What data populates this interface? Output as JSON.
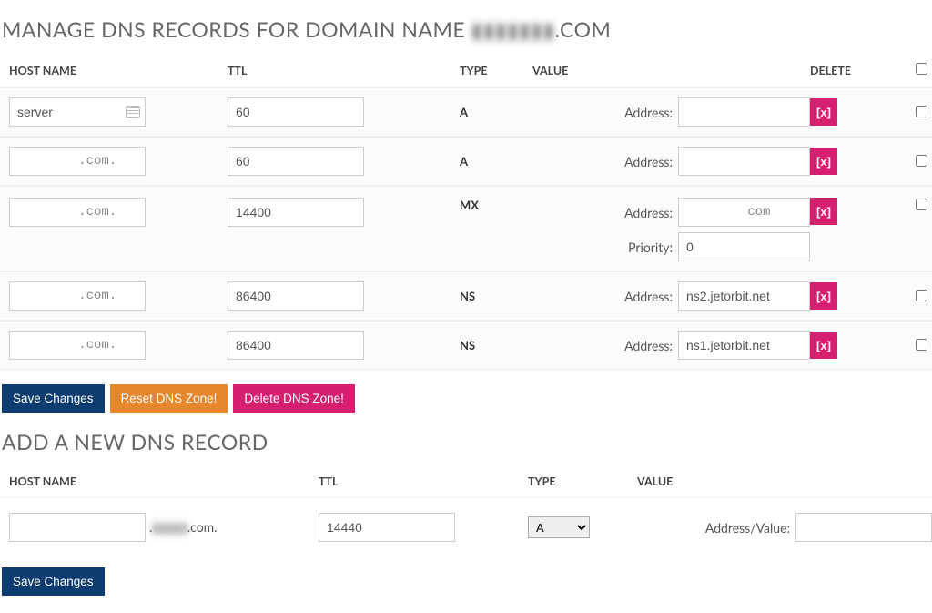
{
  "heading_prefix": "MANAGE DNS RECORDS FOR DOMAIN NAME ",
  "heading_domain_pixelated": "▮▮▮▮▮▮▮",
  "heading_suffix": ".COM",
  "columns": {
    "host": "HOST NAME",
    "ttl": "TTL",
    "type": "TYPE",
    "value": "VALUE",
    "delete": "DELETE"
  },
  "labels": {
    "address": "Address:",
    "priority": "Priority:",
    "address_value": "Address/Value:"
  },
  "records": [
    {
      "host": "server",
      "ttl": "60",
      "type": "A",
      "address": "",
      "address_blur": true,
      "priority": null,
      "show_autofill": true
    },
    {
      "host": ".com.",
      "host_blur": true,
      "ttl": "60",
      "type": "A",
      "address": "",
      "address_blur": true,
      "priority": null
    },
    {
      "host": ".com.",
      "host_blur": true,
      "ttl": "14400",
      "type": "MX",
      "address": "com",
      "address_blur": true,
      "priority": "0"
    },
    {
      "host": ".com.",
      "host_blur": true,
      "ttl": "86400",
      "type": "NS",
      "address": "ns2.jetorbit.net",
      "priority": null
    },
    {
      "host": ".com.",
      "host_blur": true,
      "ttl": "86400",
      "type": "NS",
      "address": "ns1.jetorbit.net",
      "priority": null
    }
  ],
  "delete_glyph": "[x]",
  "actions": {
    "save": "Save Changes",
    "reset": "Reset DNS Zone!",
    "delete": "Delete DNS Zone!"
  },
  "add_heading": "ADD A NEW DNS RECORD",
  "add_form": {
    "host_suffix_pixelated": ".▮▮▮▮▮.com.",
    "ttl": "14440",
    "type_selected": "A",
    "type_options": [
      "A"
    ]
  }
}
